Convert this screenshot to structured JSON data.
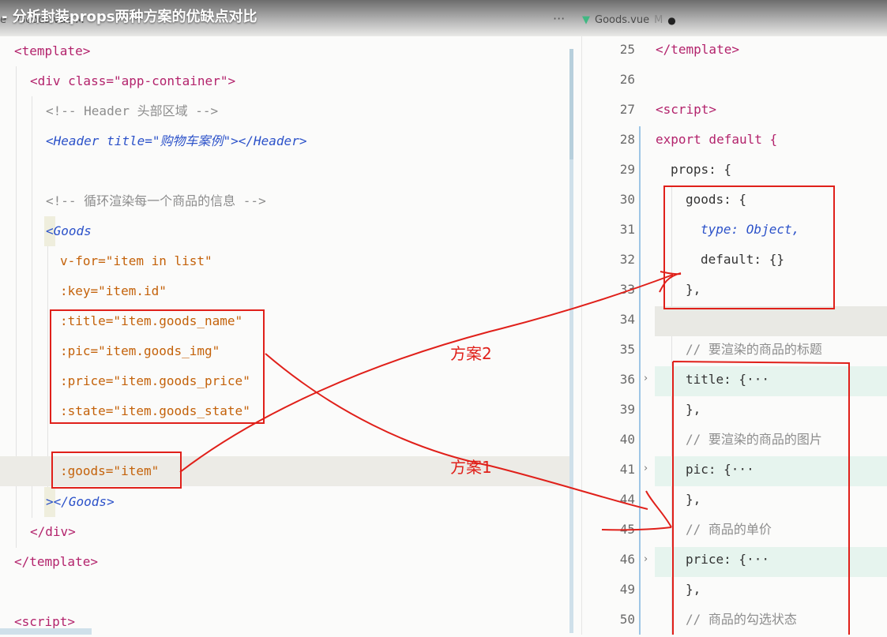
{
  "video": {
    "title": "- 分析封装props两种方案的优缺点对比"
  },
  "left_editor": {
    "tab_label": "e",
    "tab_mini": "Goods.vue M",
    "more_label": "···",
    "lines": [
      "<template>",
      "<div class=\"app-container\">",
      "<!-- Header 头部区域 -->",
      "<Header title=\"购物车案例\"></Header>",
      "",
      "<!-- 循环渲染每一个商品的信息 -->",
      "<Goods",
      "v-for=\"item in list\"",
      ":key=\"item.id\"",
      ":title=\"item.goods_name\"",
      ":pic=\"item.goods_img\"",
      ":price=\"item.goods_price\"",
      ":state=\"item.goods_state\"",
      "",
      ":goods=\"item\"",
      "></Goods>",
      "</div>",
      "</template>",
      "",
      "<script>"
    ]
  },
  "right_editor": {
    "tab_label": "Goods.vue",
    "tab_status": "M",
    "line_numbers": [
      "25",
      "26",
      "27",
      "28",
      "29",
      "30",
      "31",
      "32",
      "33",
      "34",
      "35",
      "36",
      "39",
      "40",
      "41",
      "44",
      "45",
      "46",
      "49",
      "50"
    ],
    "lines": [
      "</template>",
      "",
      "<script>",
      "export default {",
      "props: {",
      "goods: {",
      "type: Object,",
      "default: {}",
      "},",
      "",
      "// 要渲染的商品的标题",
      "title: {···",
      "},",
      "// 要渲染的商品的图片",
      "pic: {···",
      "},",
      "// 商品的单价",
      "price: {···",
      "},",
      "// 商品的勾选状态"
    ]
  },
  "annotations": {
    "plan2": "方案2",
    "plan1": "方案1"
  },
  "colors": {
    "annotation_red": "#e0201a",
    "tag": "#b3236c",
    "attr": "#c4620a",
    "component": "#2c52c9"
  }
}
